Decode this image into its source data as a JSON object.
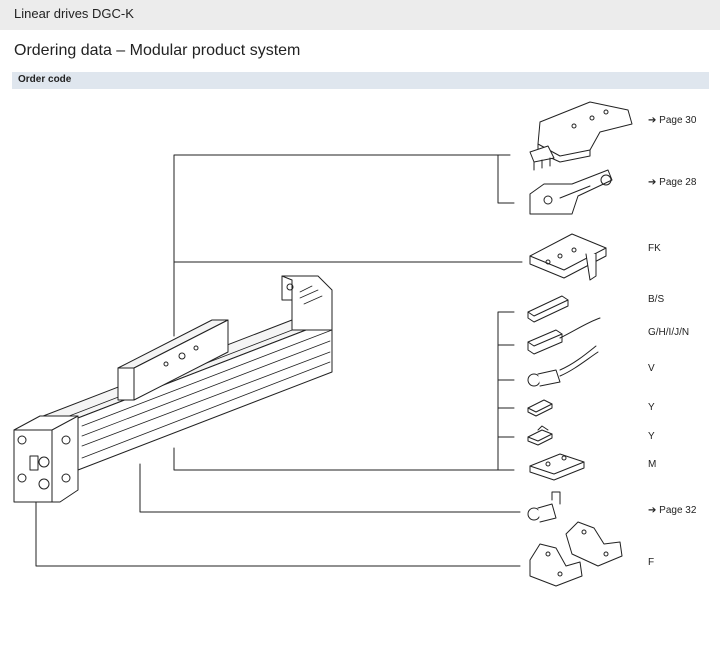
{
  "header": {
    "title": "Linear drives DGC-K"
  },
  "page_heading": "Ordering data – Modular product system",
  "section": {
    "label": "Order code"
  },
  "references": [
    {
      "id": "ref-page30",
      "text": "➔ Page 30"
    },
    {
      "id": "ref-page28",
      "text": "➔ Page 28"
    },
    {
      "id": "ref-fk",
      "text": "FK"
    },
    {
      "id": "ref-bs",
      "text": "B/S"
    },
    {
      "id": "ref-ghijn",
      "text": "G/H/I/J/N"
    },
    {
      "id": "ref-v",
      "text": "V"
    },
    {
      "id": "ref-y1",
      "text": "Y"
    },
    {
      "id": "ref-y2",
      "text": "Y"
    },
    {
      "id": "ref-m",
      "text": "M"
    },
    {
      "id": "ref-page32",
      "text": "➔ Page 32"
    },
    {
      "id": "ref-f",
      "text": "F"
    }
  ]
}
